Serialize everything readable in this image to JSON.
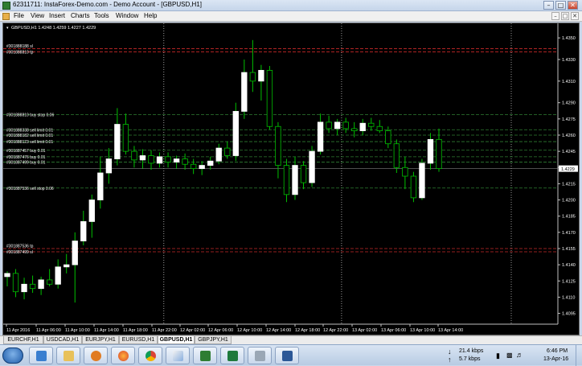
{
  "window": {
    "title": "62311711: InstaForex-Demo.com - Demo Account - [GBPUSD,H1]",
    "minimize": "–",
    "maximize": "□",
    "close": "✕"
  },
  "menu": [
    "File",
    "View",
    "Insert",
    "Charts",
    "Tools",
    "Window",
    "Help"
  ],
  "mdi_controls": [
    "–",
    "□",
    "✕"
  ],
  "chart": {
    "symbol_info": "GBPUSD,H1  1.4248 1.4259 1.4227 1.4229",
    "current_price": "1.4229",
    "colors": {
      "background": "#000000",
      "bull": "#ffffff",
      "bear": "#00c000",
      "grid": "#c0c0c0",
      "buy_line": "#2e7d32",
      "sell_line": "#c62828",
      "price_box": "#ffffff"
    },
    "icons": [
      "window-app-icon",
      "chart-menu-icon"
    ]
  },
  "chart_data": {
    "type": "candlestick",
    "symbol": "GBPUSD",
    "timeframe": "H1",
    "ylim": [
      1.4085,
      1.4362
    ],
    "y_ticks": [
      "1.4350",
      "1.4330",
      "1.4310",
      "1.4290",
      "1.4275",
      "1.4260",
      "1.4245",
      "1.4230",
      "1.4215",
      "1.4200",
      "1.4185",
      "1.4170",
      "1.4155",
      "1.4140",
      "1.4125",
      "1.4110",
      "1.4095"
    ],
    "x_ticks": [
      "11 Apr 2016",
      "11 Apr 06:00",
      "11 Apr 10:00",
      "11 Apr 14:00",
      "11 Apr 18:00",
      "11 Apr 22:00",
      "12 Apr 02:00",
      "12 Apr 06:00",
      "12 Apr 10:00",
      "12 Apr 14:00",
      "12 Apr 18:00",
      "12 Apr 22:00",
      "13 Apr 02:00",
      "13 Apr 06:00",
      "13 Apr 10:00",
      "13 Apr 14:00"
    ],
    "day_separators": [
      "12 Apr 2016",
      "13 Apr 2016",
      "14 Apr 2016"
    ],
    "orders": [
      {
        "label": "#301888188 sl",
        "price": 1.434,
        "kind": "sell"
      },
      {
        "label": "#301888810 tp",
        "price": 1.4337,
        "kind": "sell"
      },
      {
        "label": "#301888810 buy stop 0.06",
        "price": 1.4279,
        "kind": "buy"
      },
      {
        "label": "#301888338 sell limit 0.01",
        "price": 1.4265,
        "kind": "buy"
      },
      {
        "label": "#301888182 sell limit 0.01",
        "price": 1.426,
        "kind": "buy"
      },
      {
        "label": "#301888123 sell limit 0.01",
        "price": 1.4254,
        "kind": "buy"
      },
      {
        "label": "#301887457 buy 0.01",
        "price": 1.4246,
        "kind": "buy"
      },
      {
        "label": "#301887476 buy 0.01",
        "price": 1.424,
        "kind": "buy"
      },
      {
        "label": "#301887499 buy 0.01",
        "price": 1.4235,
        "kind": "buy"
      },
      {
        "label": "#301887536 sell stop 0.06",
        "price": 1.4211,
        "kind": "buy"
      },
      {
        "label": "#301887536 tp",
        "price": 1.4155,
        "kind": "sell"
      },
      {
        "label": "#301887499 sl",
        "price": 1.4152,
        "kind": "sell"
      }
    ],
    "current_price": 1.4229,
    "candles": [
      [
        1.4129,
        1.4134,
        1.412,
        1.4132
      ],
      [
        1.4132,
        1.4136,
        1.411,
        1.4115
      ],
      [
        1.4115,
        1.4128,
        1.4108,
        1.4122
      ],
      [
        1.4122,
        1.413,
        1.4114,
        1.4118
      ],
      [
        1.4118,
        1.4129,
        1.4112,
        1.4126
      ],
      [
        1.4126,
        1.4136,
        1.412,
        1.4122
      ],
      [
        1.4122,
        1.4145,
        1.4118,
        1.4138
      ],
      [
        1.4138,
        1.415,
        1.4132,
        1.414
      ],
      [
        1.414,
        1.417,
        1.4105,
        1.4162
      ],
      [
        1.4162,
        1.419,
        1.4158,
        1.418
      ],
      [
        1.418,
        1.4205,
        1.4165,
        1.42
      ],
      [
        1.42,
        1.424,
        1.4192,
        1.4225
      ],
      [
        1.4225,
        1.4248,
        1.4215,
        1.4238
      ],
      [
        1.4238,
        1.4285,
        1.4232,
        1.427
      ],
      [
        1.427,
        1.428,
        1.4242,
        1.4245
      ],
      [
        1.4245,
        1.425,
        1.423,
        1.4237
      ],
      [
        1.4237,
        1.4247,
        1.4229,
        1.4241
      ],
      [
        1.4241,
        1.4246,
        1.4228,
        1.4234
      ],
      [
        1.4234,
        1.4244,
        1.423,
        1.424
      ],
      [
        1.424,
        1.4244,
        1.423,
        1.4235
      ],
      [
        1.4235,
        1.4241,
        1.4229,
        1.4238
      ],
      [
        1.4238,
        1.4243,
        1.4228,
        1.4233
      ],
      [
        1.4233,
        1.4238,
        1.4224,
        1.4229
      ],
      [
        1.4229,
        1.4236,
        1.4223,
        1.4232
      ],
      [
        1.4232,
        1.424,
        1.4228,
        1.4236
      ],
      [
        1.4236,
        1.4252,
        1.4233,
        1.4248
      ],
      [
        1.4248,
        1.4254,
        1.4238,
        1.4241
      ],
      [
        1.4241,
        1.429,
        1.4236,
        1.4282
      ],
      [
        1.4282,
        1.433,
        1.4275,
        1.4318
      ],
      [
        1.4318,
        1.4348,
        1.43,
        1.431
      ],
      [
        1.431,
        1.4325,
        1.4292,
        1.432
      ],
      [
        1.432,
        1.4324,
        1.4265,
        1.4268
      ],
      [
        1.4268,
        1.4272,
        1.422,
        1.4232
      ],
      [
        1.4232,
        1.4238,
        1.4198,
        1.4205
      ],
      [
        1.4205,
        1.424,
        1.42,
        1.4232
      ],
      [
        1.4232,
        1.4236,
        1.421,
        1.4216
      ],
      [
        1.4216,
        1.425,
        1.4212,
        1.4245
      ],
      [
        1.4245,
        1.428,
        1.4242,
        1.4272
      ],
      [
        1.4272,
        1.4278,
        1.4262,
        1.4266
      ],
      [
        1.4266,
        1.4275,
        1.426,
        1.4272
      ],
      [
        1.4272,
        1.4276,
        1.4262,
        1.4266
      ],
      [
        1.4266,
        1.4272,
        1.4258,
        1.4264
      ],
      [
        1.4264,
        1.4275,
        1.426,
        1.4271
      ],
      [
        1.4271,
        1.4276,
        1.4264,
        1.4268
      ],
      [
        1.4268,
        1.4274,
        1.4262,
        1.4264
      ],
      [
        1.4264,
        1.4268,
        1.4248,
        1.4252
      ],
      [
        1.4252,
        1.4256,
        1.4225,
        1.423
      ],
      [
        1.423,
        1.424,
        1.421,
        1.4222
      ],
      [
        1.4222,
        1.4226,
        1.4198,
        1.4202
      ],
      [
        1.4202,
        1.4238,
        1.42,
        1.4234
      ],
      [
        1.4234,
        1.4262,
        1.4228,
        1.4256
      ],
      [
        1.4256,
        1.4266,
        1.4226,
        1.4229
      ]
    ]
  },
  "tabs": [
    "EURCHF,H1",
    "USDCAD,H1",
    "EURJPY,H1",
    "EURUSD,H1",
    "GBPUSD,H1",
    "GBPJPY,H1"
  ],
  "active_tab": "GBPUSD,H1",
  "taskbar": {
    "apps": [
      "explorer-icon",
      "folder-icon",
      "media-player-icon",
      "firefox-icon",
      "chrome-icon",
      "paint-icon",
      "metatrader-icon",
      "excel-icon",
      "calculator-icon",
      "word-icon"
    ],
    "net_down": "21.4 kbps",
    "net_up": "5.7 kbps",
    "time": "6:46 PM",
    "date": "13-Apr-16"
  }
}
